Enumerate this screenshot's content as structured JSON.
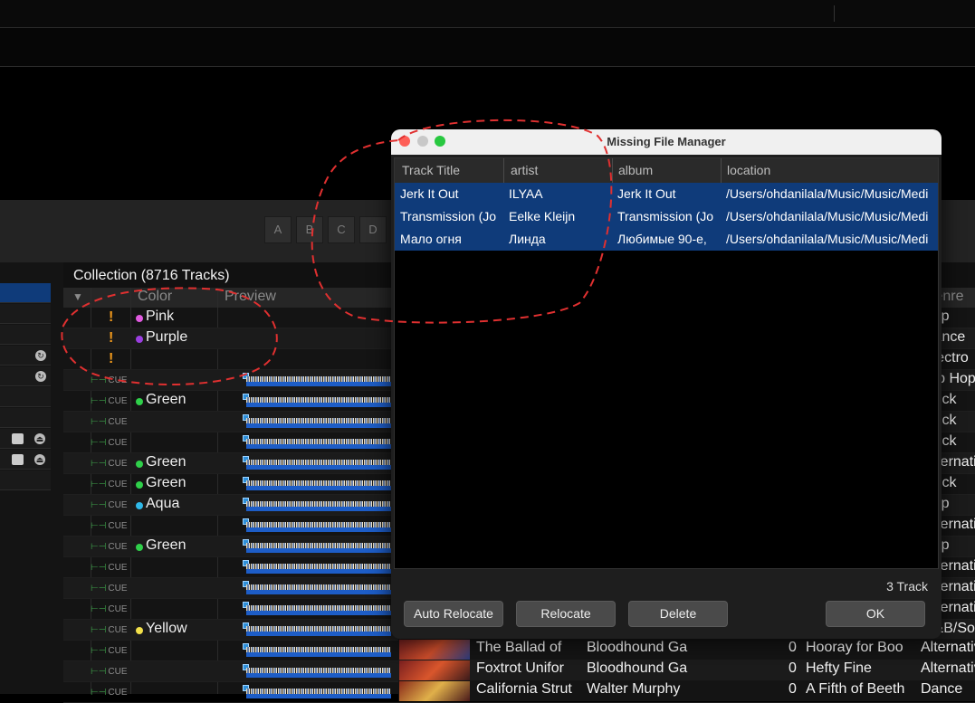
{
  "hotcues": [
    "A",
    "B",
    "C",
    "D"
  ],
  "collection": {
    "title": "Collection (8716 Tracks)",
    "columns": {
      "color": "Color",
      "preview": "Preview",
      "genre": "Genre"
    },
    "rows": [
      {
        "cue": "",
        "warn": "!",
        "color": "Pink",
        "dot": "#e05be0",
        "genre": "Pop"
      },
      {
        "cue": "",
        "warn": "!",
        "color": "Purple",
        "dot": "#9b3fe0",
        "genre": "Dance"
      },
      {
        "cue": "",
        "warn": "!",
        "color": "",
        "dot": "",
        "genre": "Electro"
      },
      {
        "cue": "CUE",
        "warn": "",
        "color": "",
        "dot": "",
        "genre": "Hip Hop"
      },
      {
        "cue": "CUE",
        "warn": "",
        "color": "Green",
        "dot": "#2fd04a",
        "genre": "Rock"
      },
      {
        "cue": "CUE",
        "warn": "",
        "color": "",
        "dot": "",
        "genre": "Rock"
      },
      {
        "cue": "CUE",
        "warn": "",
        "color": "",
        "dot": "",
        "genre": "Rock"
      },
      {
        "cue": "CUE",
        "warn": "",
        "color": "Green",
        "dot": "#2fd04a",
        "genre": "Alternative"
      },
      {
        "cue": "CUE",
        "warn": "",
        "color": "Green",
        "dot": "#2fd04a",
        "genre": "Rock"
      },
      {
        "cue": "CUE",
        "warn": "",
        "color": "Aqua",
        "dot": "#2fb8e8",
        "genre": "Pop"
      },
      {
        "cue": "CUE",
        "warn": "",
        "color": "",
        "dot": "",
        "genre": "Alternative"
      },
      {
        "cue": "CUE",
        "warn": "",
        "color": "Green",
        "dot": "#2fd04a",
        "genre": "Pop"
      },
      {
        "cue": "CUE",
        "warn": "",
        "color": "",
        "dot": "",
        "genre": "Alternative"
      },
      {
        "cue": "CUE",
        "warn": "",
        "color": "",
        "dot": "",
        "genre": "Alternative"
      },
      {
        "cue": "CUE",
        "warn": "",
        "color": "",
        "dot": "",
        "genre": "Alternative"
      },
      {
        "cue": "CUE",
        "warn": "",
        "color": "Yellow",
        "dot": "#f2e04a",
        "genre": "R&B/Soul"
      },
      {
        "cue": "CUE",
        "warn": "",
        "color": "",
        "dot": "",
        "genre": "Alternative"
      },
      {
        "cue": "CUE",
        "warn": "",
        "color": "",
        "dot": "",
        "genre": "Alternative"
      },
      {
        "cue": "CUE",
        "warn": "",
        "color": "",
        "dot": "",
        "genre": "Dance"
      }
    ],
    "bottom_rows": [
      {
        "title": "The Ballad of",
        "artist": "Bloodhound Ga",
        "num": "0",
        "album": "Hooray for Boo"
      },
      {
        "title": "Foxtrot Unifor",
        "artist": "Bloodhound Ga",
        "num": "0",
        "album": "Hefty Fine"
      },
      {
        "title": "California Strut",
        "artist": "Walter Murphy",
        "num": "0",
        "album": "A Fifth of Beeth"
      }
    ]
  },
  "dialog": {
    "title": "Missing File Manager",
    "columns": [
      "Track Title",
      "artist",
      "album",
      "location"
    ],
    "rows": [
      {
        "title": "Jerk It Out",
        "artist": "ILYAA",
        "album": "Jerk It Out",
        "location": "/Users/ohdanilala/Music/Music/Medi"
      },
      {
        "title": "Transmission (Jo",
        "artist": "Eelke Kleijn",
        "album": "Transmission (Jo",
        "location": "/Users/ohdanilala/Music/Music/Medi"
      },
      {
        "title": "Мало огня",
        "artist": "Линда",
        "album": "Любимые 90-е,",
        "location": "/Users/ohdanilala/Music/Music/Medi"
      }
    ],
    "count": "3 Track",
    "buttons": {
      "auto_relocate": "Auto Relocate",
      "relocate": "Relocate",
      "delete": "Delete",
      "ok": "OK"
    }
  },
  "colors": {
    "selection": "#0f3b7a",
    "annotation": "#e03030"
  }
}
